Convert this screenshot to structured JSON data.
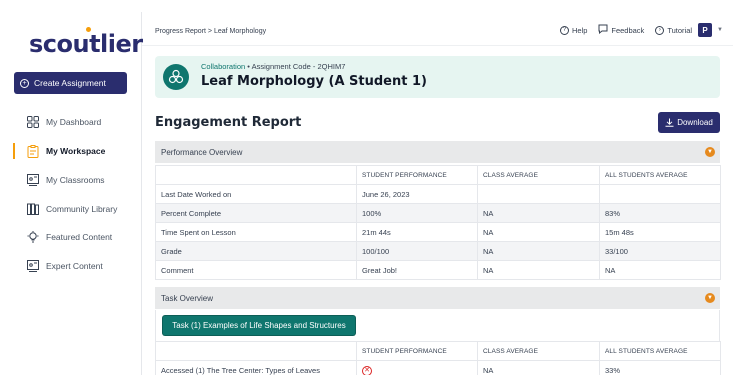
{
  "app": {
    "logo": "scoutlier",
    "create_button": "Create Assignment"
  },
  "sidebar": {
    "items": [
      {
        "label": "My Dashboard",
        "icon": "dashboard-icon"
      },
      {
        "label": "My Workspace",
        "icon": "workspace-icon",
        "active": true
      },
      {
        "label": "My Classrooms",
        "icon": "classroom-icon"
      },
      {
        "label": "Community Library",
        "icon": "library-icon"
      },
      {
        "label": "Featured Content",
        "icon": "featured-icon"
      },
      {
        "label": "Expert Content",
        "icon": "expert-icon"
      }
    ]
  },
  "header": {
    "breadcrumb": "Progress Report > Leaf Morphology",
    "help": "Help",
    "feedback": "Feedback",
    "tutorial": "Tutorial",
    "avatar_initial": "P"
  },
  "assignment": {
    "category": "Collaboration",
    "separator": "•",
    "code_label": "Assignment Code - 2QHIM7",
    "title": "Leaf Morphology (A Student 1)"
  },
  "report": {
    "title": "Engagement Report",
    "download": "Download"
  },
  "performance": {
    "title": "Performance Overview",
    "columns": [
      "STUDENT PERFORMANCE",
      "CLASS AVERAGE",
      "ALL STUDENTS AVERAGE"
    ],
    "rows": [
      {
        "label": "Last Date Worked on",
        "student": "June 26, 2023",
        "class": "",
        "all": ""
      },
      {
        "label": "Percent Complete",
        "student": "100%",
        "class": "NA",
        "all": "83%"
      },
      {
        "label": "Time Spent on Lesson",
        "student": "21m 44s",
        "class": "NA",
        "all": "15m 48s"
      },
      {
        "label": "Grade",
        "student": "100/100",
        "class": "NA",
        "all": "33/100"
      },
      {
        "label": "Comment",
        "student": "Great Job!",
        "class": "NA",
        "all": "NA"
      }
    ]
  },
  "task": {
    "title": "Task Overview",
    "task_button": "Task (1) Examples of Life Shapes and Structures",
    "columns": [
      "STUDENT PERFORMANCE",
      "CLASS AVERAGE",
      "ALL STUDENTS AVERAGE"
    ],
    "rows": [
      {
        "label": "Accessed (1) The Tree Center: Types of Leaves",
        "student_icon": "x-circle-icon",
        "class": "NA",
        "all": "33%"
      }
    ]
  },
  "colors": {
    "brand": "#2a2d6e",
    "teal": "#0f766e",
    "accent": "#f59e0b"
  }
}
